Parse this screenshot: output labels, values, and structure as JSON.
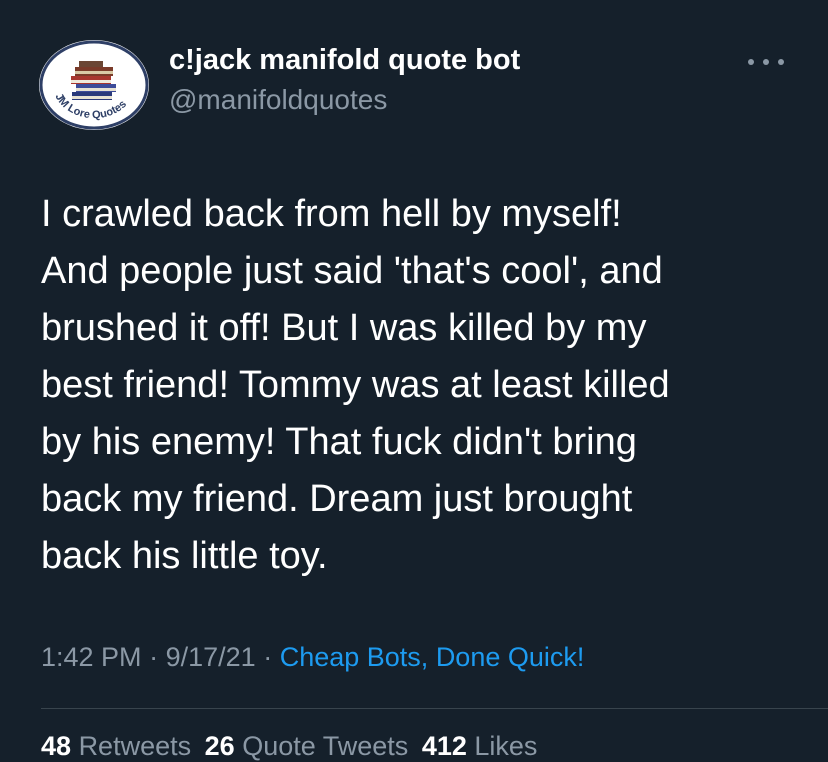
{
  "user": {
    "display_name": "c!jack manifold quote bot",
    "handle": "@manifoldquotes",
    "avatar_text": "JM Lore Quotes",
    "avatar_icon": "book-stack-icon"
  },
  "tweet": {
    "text": "I crawled back from hell by myself!\nAnd people just said 'that's cool', and\nbrushed it off! But I was killed by my\nbest friend! Tommy was at least killed\nby his enemy! That fuck didn't bring\nback my friend. Dream just brought\nback his little toy.",
    "time": "1:42 PM",
    "date": "9/17/21",
    "separator": "·",
    "source": "Cheap Bots, Done Quick!"
  },
  "stats": {
    "retweets_count": "48",
    "retweets_label": "Retweets",
    "quotes_count": "26",
    "quotes_label": "Quote Tweets",
    "likes_count": "412",
    "likes_label": "Likes"
  },
  "colors": {
    "background": "#15202b",
    "text": "#ffffff",
    "secondary": "#8b98a5",
    "link": "#1d9bf0"
  }
}
